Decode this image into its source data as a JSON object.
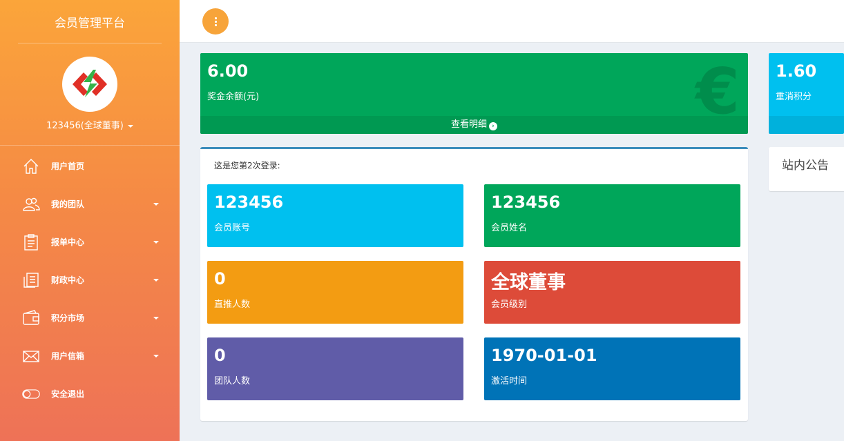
{
  "sidebar": {
    "brand": "会员管理平台",
    "user_label": "123456(全球董事)",
    "menu": [
      {
        "label": "用户首页",
        "icon": "home-icon",
        "has_caret": false
      },
      {
        "label": "我的团队",
        "icon": "users-icon",
        "has_caret": true
      },
      {
        "label": "报单中心",
        "icon": "clipboard-icon",
        "has_caret": true
      },
      {
        "label": "财政中心",
        "icon": "ledger-icon",
        "has_caret": true
      },
      {
        "label": "积分市场",
        "icon": "wallet-icon",
        "has_caret": true
      },
      {
        "label": "用户信箱",
        "icon": "envelope-icon",
        "has_caret": true
      },
      {
        "label": "安全退出",
        "icon": "toggle-icon",
        "has_caret": false
      }
    ]
  },
  "topbar": {
    "menu_button_icon": "vertical-dots-icon"
  },
  "stats": {
    "bonus": {
      "value": "6.00",
      "label": "奖金余额(元)",
      "footer": "查看明细",
      "icon": "euro-icon",
      "color": "#00a65a"
    },
    "points": {
      "value": "1.60",
      "label": "重消积分",
      "color": "#00c0ef"
    }
  },
  "panel": {
    "login_info": "这是您第2次登录:",
    "tiles": [
      {
        "value": "123456",
        "label": "会员账号",
        "color": "#00c0ef"
      },
      {
        "value": "123456",
        "label": "会员姓名",
        "color": "#00a65a"
      },
      {
        "value": "0",
        "label": "直推人数",
        "color": "#f39c12"
      },
      {
        "value": "全球董事",
        "label": "会员级别",
        "color": "#dd4b39"
      },
      {
        "value": "0",
        "label": "团队人数",
        "color": "#605ca8"
      },
      {
        "value": "1970-01-01",
        "label": "激活时间",
        "color": "#0073b7"
      }
    ]
  },
  "notice": {
    "title": "站内公告"
  },
  "colors": {
    "accent": "#f7a43a",
    "panel_border": "#3c8dbc"
  }
}
